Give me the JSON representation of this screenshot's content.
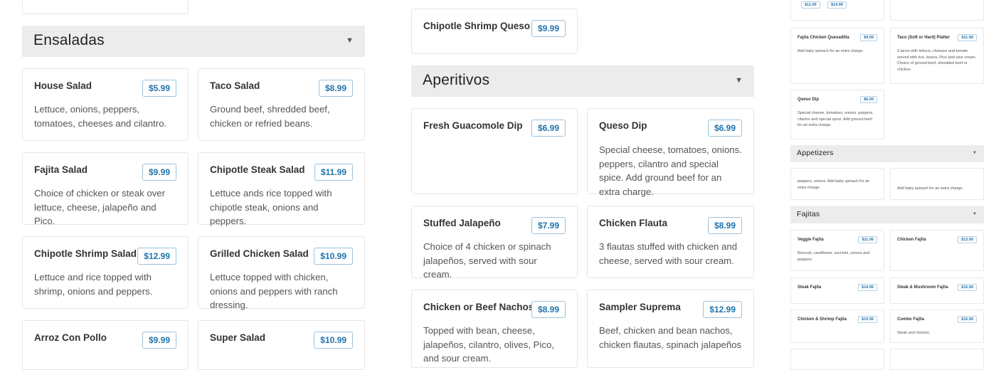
{
  "colors": {
    "accent": "#1f73ad",
    "section_bg": "#ececec",
    "card_border": "#e6e6e6"
  },
  "left": {
    "section_title": "Ensaladas",
    "items": [
      {
        "name": "House Salad",
        "price": "$5.99",
        "desc": "Lettuce, onions, peppers, tomatoes, cheeses and cilantro."
      },
      {
        "name": "Taco Salad",
        "price": "$8.99",
        "desc": "Ground beef, shredded beef, chicken or refried beans."
      },
      {
        "name": "Fajita Salad",
        "price": "$9.99",
        "desc": "Choice of chicken or steak over lettuce, cheese, jalapeño and Pico."
      },
      {
        "name": "Chipotle Steak Salad",
        "price": "$11.99",
        "desc": "Lettuce ands rice topped with chipotle steak, onions and peppers."
      },
      {
        "name": "Chipotle Shrimp Salad",
        "price": "$12.99",
        "desc": "Lettuce and rice topped with shrimp, onions and peppers."
      },
      {
        "name": "Grilled Chicken Salad",
        "price": "$10.99",
        "desc": "Lettuce topped with chicken, onions and peppers with ranch dressing."
      },
      {
        "name": "Arroz Con Pollo",
        "price": "$9.99",
        "desc": ""
      },
      {
        "name": "Super Salad",
        "price": "$10.99",
        "desc": ""
      }
    ]
  },
  "middle": {
    "top_item": {
      "name": "Chipotle Shrimp Queso Dip",
      "price": "$9.99"
    },
    "section_title": "Aperitivos",
    "items": [
      {
        "name": "Fresh Guacomole Dip",
        "price": "$6.99",
        "desc": ""
      },
      {
        "name": "Queso Dip",
        "price": "$6.99",
        "desc": "Special cheese, tomatoes, onions. peppers, cilantro and special spice. Add ground beef for an extra charge."
      },
      {
        "name": "Stuffed Jalapeño",
        "price": "$7.99",
        "desc": "Choice of 4 chicken or spinach jalapeños, served with sour cream."
      },
      {
        "name": "Chicken Flauta",
        "price": "$8.99",
        "desc": "3 flautas stuffed with chicken and cheese, served with sour cream."
      },
      {
        "name": "Chicken or Beef Nachos",
        "price": "$8.99",
        "desc": "Topped with bean, cheese, jalapeños, cilantro, olives, Pico, and sour cream."
      },
      {
        "name": "Sampler Suprema",
        "price": "$12.99",
        "desc": "Beef, chicken and bean nachos, chicken flautas, spinach jalapeños"
      }
    ]
  },
  "right": {
    "top_prices": [
      "$11.99",
      "$14.99"
    ],
    "cards": [
      {
        "name": "Fajita Chicken Quesadilla",
        "price": "$9.99",
        "desc": "Add baby spinach for an extra charge."
      },
      {
        "name": "Taco (Soft or Hard) Platter",
        "price": "$11.99",
        "desc": "3 tacos with lettuce, cheeses and tomato served with rice, beans, Pico and sour cream. Choice of ground beef, shredded beef or chicken."
      },
      {
        "name": "Queso Dip",
        "price": "$6.99",
        "desc": "Special cheese, tomatoes, onions. peppers, cilantro and special spice. Add ground beef for an extra charge."
      }
    ],
    "section_appetizers": "Appetizers",
    "appetizer_snippets": [
      "peppers, onions. Add baby spinach for an extra charge.",
      "Add baby spinach for an extra charge."
    ],
    "section_fajitas": "Fajitas",
    "fajitas": [
      {
        "name": "Veggie Fajita",
        "price": "$11.99",
        "desc": "Broccoli, cauliflower, zucchini, onions and peppers."
      },
      {
        "name": "Chicken Fajita",
        "price": "$13.99",
        "desc": ""
      },
      {
        "name": "Steak Fajita",
        "price": "$14.99",
        "desc": ""
      },
      {
        "name": "Steak & Mushroom Fajita",
        "price": "$15.99",
        "desc": ""
      },
      {
        "name": "Chicken & Shrimp Fajita",
        "price": "$15.99",
        "desc": ""
      },
      {
        "name": "Combo Fajita",
        "price": "$15.99",
        "desc": "Steak and chicken."
      }
    ],
    "arrow": "▼"
  }
}
